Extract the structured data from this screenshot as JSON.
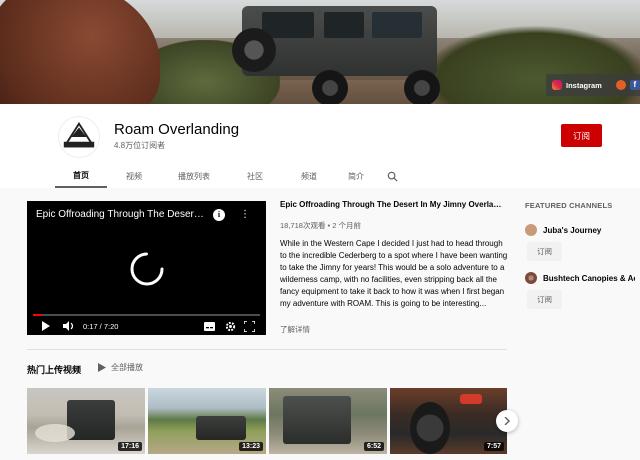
{
  "banner": {
    "social": {
      "instagram_label": "Instagram",
      "fb_letter": "f"
    }
  },
  "channel": {
    "name": "Roam Overlanding",
    "subscribers": "4.8万位订阅者",
    "subscribe_label": "订阅",
    "logo_text": "ROAM OVERLANDING"
  },
  "tabs": [
    {
      "label": "首页",
      "active": true
    },
    {
      "label": "视频"
    },
    {
      "label": "播放列表"
    },
    {
      "label": "社区"
    },
    {
      "label": "频道"
    },
    {
      "label": "简介"
    }
  ],
  "player": {
    "title": "Epic Offroading Through The Desert In My Jimny Overlander (ROAM Adventure)",
    "time": "0:17 / 7:20",
    "progress": 0.04
  },
  "video": {
    "title": "Epic Offroading Through The Desert In My Jimny Overlander (ROAM Adventure)",
    "meta": "18,718次观看 • 2 个月前",
    "description": "While in the Western Cape I decided I just had to head through to the incredible Cederberg to a spot where I have been wanting to take the Jimny for years! This would be a solo adventure to a wilderness camp, with no facilities, even stripping back all the fancy equipment to take it back to how it was when I first began my adventure with ROAM. This is going to be interesting...",
    "read_more": "了解详情"
  },
  "featured": {
    "title": "FEATURED CHANNELS",
    "channels": [
      {
        "name": "Juba's Journey",
        "subscribe": "订阅",
        "color": "#c99a7a"
      },
      {
        "name": "Bushtech Canopies & Accessories",
        "subscribe": "订阅",
        "color": "#8a5a4a"
      }
    ]
  },
  "uploads": {
    "title": "热门上传视频",
    "play_all": "全部播放",
    "durations": [
      "17:16",
      "13:23",
      "6:52",
      "7:57"
    ]
  },
  "colors": {
    "accent": "#cc0000",
    "progress": "#ff0000"
  }
}
